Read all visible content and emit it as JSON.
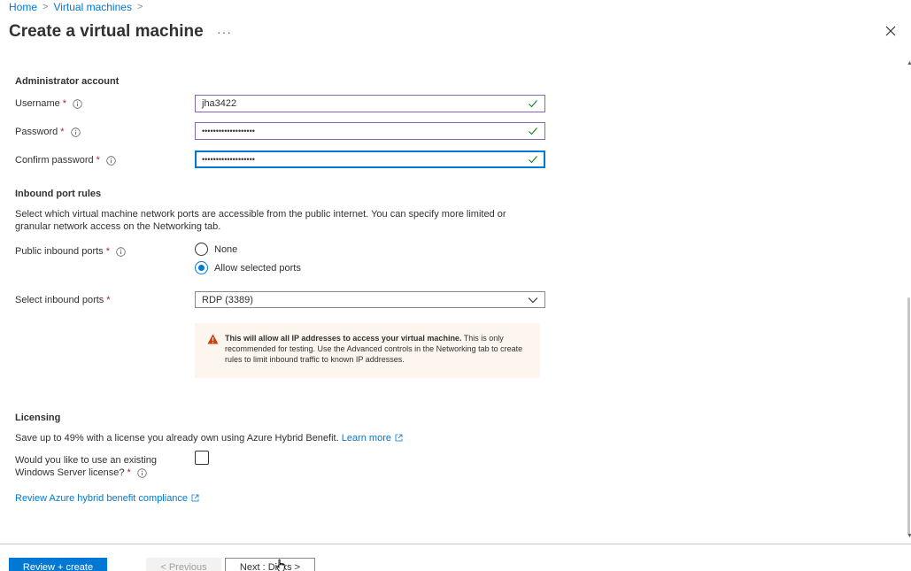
{
  "breadcrumb": {
    "items": [
      "Home",
      "Virtual machines"
    ],
    "separator": ">"
  },
  "page": {
    "title": "Create a virtual machine",
    "more_label": "···",
    "close_label": "Close"
  },
  "admin": {
    "heading": "Administrator account",
    "username_label": "Username",
    "username_value": "jha3422",
    "password_label": "Password",
    "password_value": "•••••••••••••••••••",
    "confirm_label": "Confirm password",
    "confirm_value": "•••••••••••••••••••",
    "required_mark": "*"
  },
  "inbound": {
    "heading": "Inbound port rules",
    "description": "Select which virtual machine network ports are accessible from the public internet. You can specify more limited or granular network access on the Networking tab.",
    "public_label": "Public inbound ports",
    "options": [
      "None",
      "Allow selected ports"
    ],
    "selected_option": "Allow selected ports",
    "select_label": "Select inbound ports",
    "select_value": "RDP (3389)",
    "warning_bold": "This will allow all IP addresses to access your virtual machine.",
    "warning_text": " This is only recommended for testing.  Use the Advanced controls in the Networking tab to create rules to limit inbound traffic to known IP addresses."
  },
  "licensing": {
    "heading": "Licensing",
    "description": "Save up to 49% with a license you already own using Azure Hybrid Benefit.",
    "learn_more": "Learn more",
    "question_line1": "Would you like to use an existing",
    "question_line2": "Windows Server license?",
    "checked": false,
    "review_link": "Review Azure hybrid benefit compliance"
  },
  "footer": {
    "review_create": "Review + create",
    "previous": "< Previous",
    "next": "Next : Disks >"
  },
  "colors": {
    "accent": "#0078d4",
    "valid_border": "#8764b8",
    "required": "#a4262c",
    "success": "#107c10",
    "warning_bg": "#fdf6ee",
    "warning_icon": "#d83b01"
  }
}
